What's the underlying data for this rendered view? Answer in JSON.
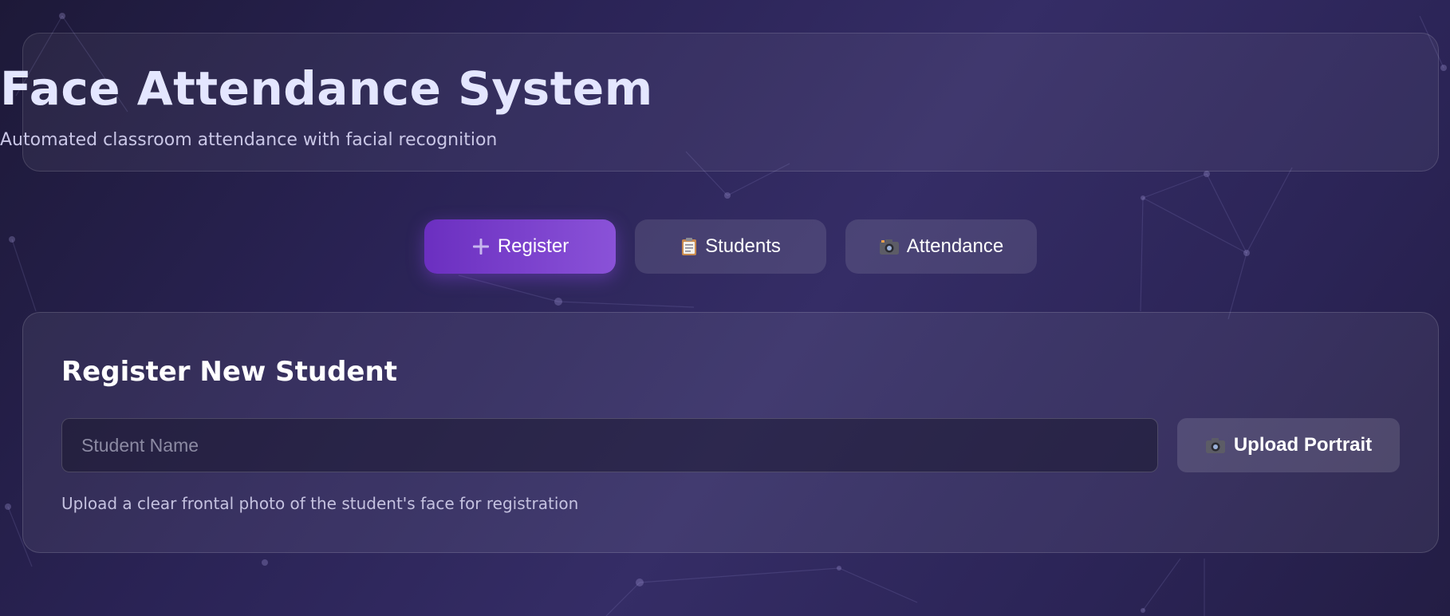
{
  "header": {
    "title": "Face Attendance System",
    "subtitle": "Automated classroom attendance with facial recognition"
  },
  "tabs": [
    {
      "label": "Register",
      "icon": "plus-icon",
      "active": true
    },
    {
      "label": "Students",
      "icon": "clipboard-icon",
      "active": false
    },
    {
      "label": "Attendance",
      "icon": "camera-icon",
      "active": false
    }
  ],
  "register_panel": {
    "title": "Register New Student",
    "name_placeholder": "Student Name",
    "name_value": "",
    "upload_label": "Upload Portrait",
    "upload_icon": "camera-icon",
    "hint": "Upload a clear frontal photo of the student's face for registration"
  },
  "colors": {
    "accent_start": "#6b2fc0",
    "accent_end": "#8a52d8",
    "title": "#e4e6ff",
    "background": "#2a2355"
  }
}
